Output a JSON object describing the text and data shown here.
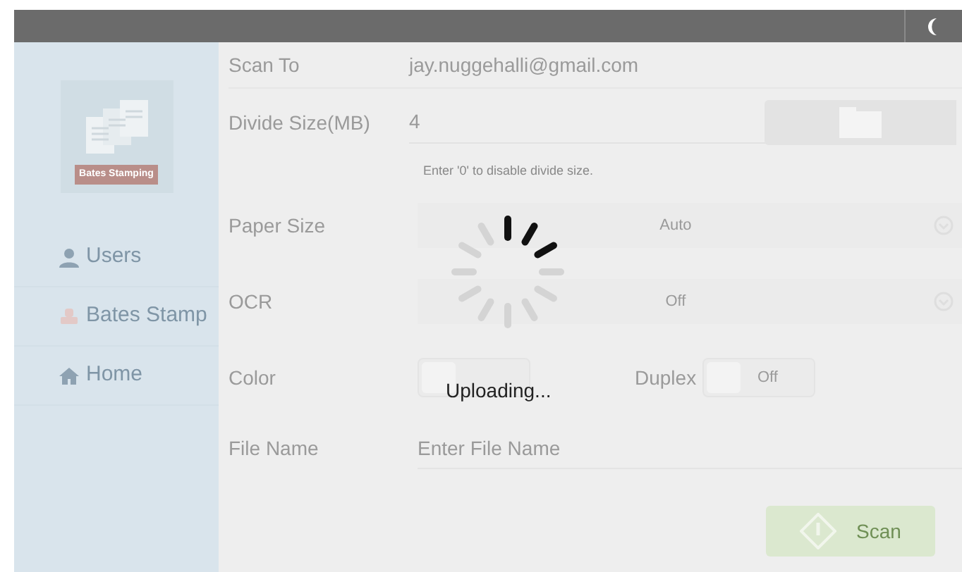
{
  "sidebar": {
    "logo_caption": "Bates Stamping",
    "items": [
      {
        "label": "Users",
        "kind": "user"
      },
      {
        "label": "Bates Stamp",
        "kind": "stamp"
      },
      {
        "label": "Home",
        "kind": "home"
      }
    ]
  },
  "form": {
    "scan_to": {
      "label": "Scan To",
      "value": "jay.nuggehalli@gmail.com"
    },
    "divide_size": {
      "label": "Divide Size(MB)",
      "value": "4",
      "hint": "Enter '0' to disable divide size."
    },
    "paper_size": {
      "label": "Paper Size",
      "value": "Auto"
    },
    "ocr": {
      "label": "OCR",
      "value": "Off"
    },
    "color": {
      "label": "Color",
      "on": false
    },
    "duplex": {
      "label": "Duplex",
      "on": false,
      "text": "Off"
    },
    "file_name": {
      "label": "File Name",
      "placeholder": "Enter File Name"
    },
    "scan_button": "Scan"
  },
  "overlay": {
    "message": "Uploading..."
  }
}
